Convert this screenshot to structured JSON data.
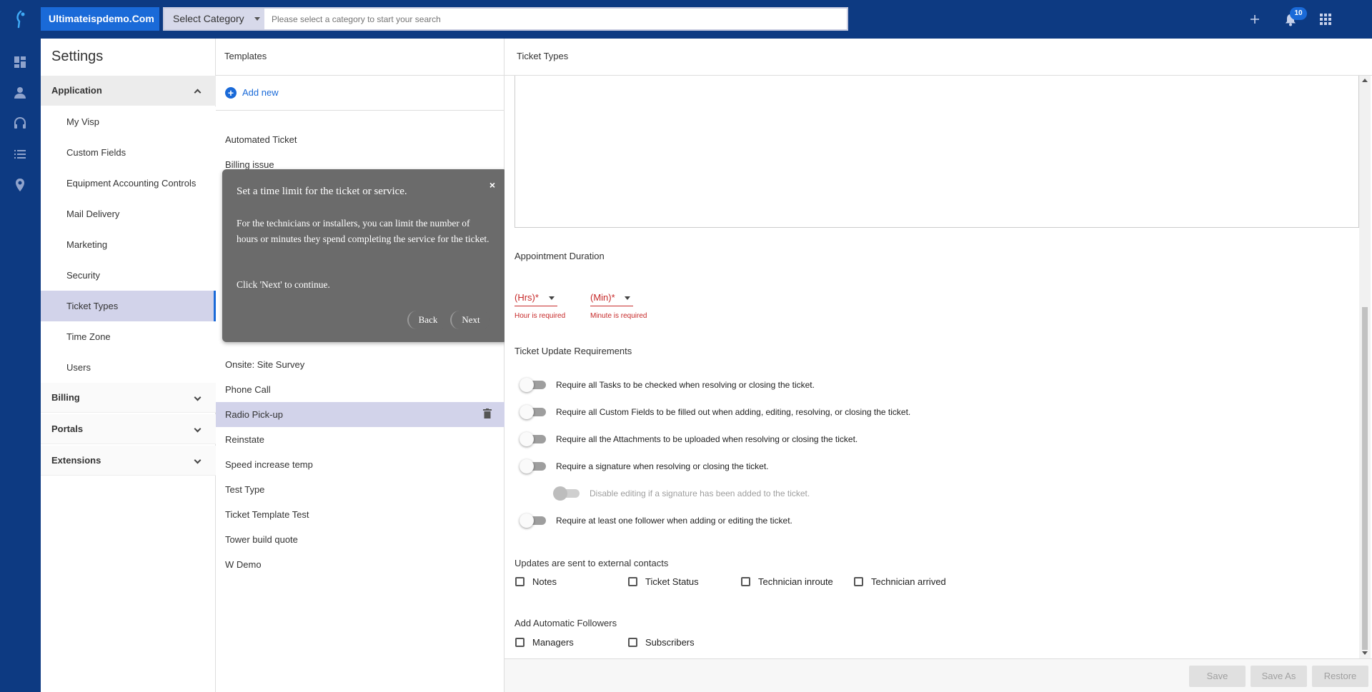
{
  "topbar": {
    "brand": "Ultimateispdemo.Com",
    "category_select": "Select Category",
    "search_placeholder": "Please select a category to start your search",
    "notification_count": "10",
    "icons": [
      "logo-icon",
      "plus-icon",
      "bell-icon",
      "apps-grid-icon"
    ]
  },
  "rail": {
    "icons": [
      "dashboard-icon",
      "person-icon",
      "headset-icon",
      "list-icon",
      "location-pin-icon"
    ],
    "help": "?"
  },
  "settings": {
    "title": "Settings",
    "sections": {
      "application": "Application",
      "billing": "Billing",
      "portals": "Portals",
      "extensions": "Extensions"
    },
    "items": [
      "My Visp",
      "Custom Fields",
      "Equipment Accounting Controls",
      "Mail Delivery",
      "Marketing",
      "Security",
      "Ticket Types",
      "Time Zone",
      "Users"
    ],
    "selected_item": "Ticket Types"
  },
  "templates": {
    "title": "Templates",
    "add_new": "Add new",
    "items": [
      "Automated Ticket",
      "Billing issue",
      "Onsite: Site Survey",
      "Phone Call",
      "Radio Pick-up",
      "Reinstate",
      "Speed increase temp",
      "Test Type",
      "Ticket Template Test",
      "Tower build quote",
      "W Demo"
    ],
    "selected_item": "Radio Pick-up"
  },
  "tour": {
    "title": "Set a time limit for the ticket or service.",
    "body": "For the technicians or installers, you can limit the number of hours or minutes they spend completing the service for the ticket.",
    "continue": "Click 'Next' to continue.",
    "close": "×",
    "back": "Back",
    "next": "Next"
  },
  "ticket_types": {
    "title": "Ticket Types",
    "appointment_duration": {
      "label": "Appointment Duration",
      "hours_placeholder": "(Hrs)*",
      "minutes_placeholder": "(Min)*",
      "hours_error": "Hour is required",
      "minutes_error": "Minute is required"
    },
    "update_requirements": {
      "label": "Ticket Update Requirements",
      "toggles": [
        "Require all Tasks to be checked when resolving or closing the ticket.",
        "Require all Custom Fields to be filled out when adding, editing, resolving, or closing the ticket.",
        "Require all the Attachments to be uploaded when resolving or closing the ticket.",
        "Require a signature when resolving or closing the ticket.",
        "Disable editing if a signature has been added to the ticket.",
        "Require at least one follower when adding or editing the ticket."
      ]
    },
    "external_contacts": {
      "label": "Updates are sent to external contacts",
      "options": [
        "Notes",
        "Ticket Status",
        "Technician inroute",
        "Technician arrived"
      ]
    },
    "automatic_followers": {
      "label": "Add Automatic Followers",
      "options": [
        "Managers",
        "Subscribers"
      ]
    },
    "actions": {
      "save": "Save",
      "save_as": "Save As",
      "restore": "Restore"
    }
  },
  "colors": {
    "nav_blue": "#0d3a82",
    "accent_blue": "#1a6ad8",
    "selection": "#d2d3ea",
    "error_red": "#c62828",
    "tour_gray": "#6b6b6b"
  }
}
